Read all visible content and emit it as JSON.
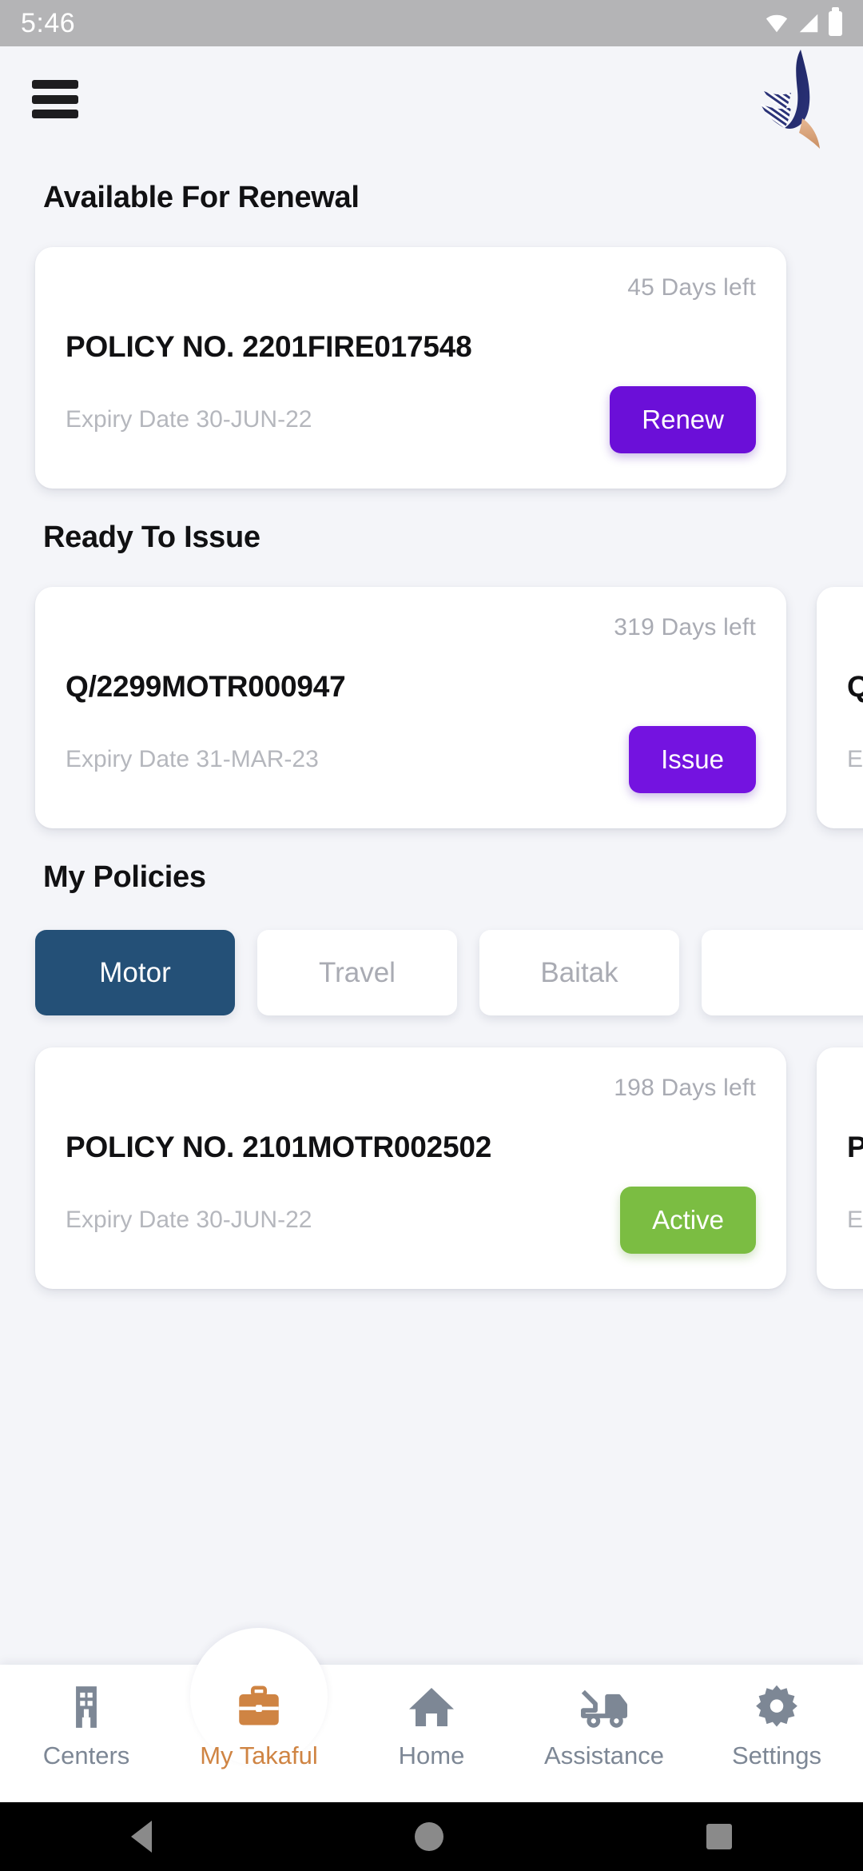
{
  "statusbar": {
    "time": "5:46",
    "icons": [
      "wifi-icon",
      "signal-icon",
      "battery-icon"
    ]
  },
  "header": {
    "menu_icon": "hamburger-menu-icon",
    "logo": "company-logo"
  },
  "sections": [
    {
      "title": "Available For Renewal",
      "cards": [
        {
          "days_left": "45 Days left",
          "policy_no": "POLICY NO. 2201FIRE017548",
          "expiry": "Expiry Date 30-JUN-22",
          "cta": "Renew",
          "cta_color": "#6b0fd8"
        }
      ]
    },
    {
      "title": "Ready To Issue",
      "cards": [
        {
          "days_left": "319 Days left",
          "policy_no": "Q/2299MOTR000947",
          "expiry": "Expiry Date 31-MAR-23",
          "cta": "Issue",
          "cta_color": "#7413e0"
        },
        {
          "days_left": "",
          "policy_no": "Q",
          "expiry": "E",
          "cta": "",
          "cta_color": "#7413e0"
        }
      ]
    },
    {
      "title": "My Policies",
      "tabs": [
        {
          "label": "Motor",
          "active": true
        },
        {
          "label": "Travel",
          "active": false
        },
        {
          "label": "Baitak",
          "active": false
        },
        {
          "label": "",
          "active": false
        }
      ],
      "cards": [
        {
          "days_left": "198 Days left",
          "policy_no": "POLICY NO. 2101MOTR002502",
          "expiry": "Expiry Date 30-JUN-22",
          "cta": "Active",
          "cta_color": "#7bbd42"
        },
        {
          "days_left": "",
          "policy_no": "P",
          "expiry": "E",
          "cta": "",
          "cta_color": "#7bbd42"
        }
      ]
    }
  ],
  "bottomnav": [
    {
      "label": "Centers",
      "icon": "building-icon",
      "active": false
    },
    {
      "label": "My Takaful",
      "icon": "briefcase-icon",
      "active": true
    },
    {
      "label": "Home",
      "icon": "house-icon",
      "active": false
    },
    {
      "label": "Assistance",
      "icon": "tow-truck-icon",
      "active": false
    },
    {
      "label": "Settings",
      "icon": "gear-icon",
      "active": false
    }
  ],
  "sysnav": [
    "back-button",
    "home-button",
    "recents-button"
  ],
  "colors": {
    "background": "#f4f5f9",
    "accent_purple": "#6b0fd8",
    "accent_green": "#7bbd42",
    "tab_active_blue": "#245077",
    "nav_active_orange": "#cf8443",
    "muted_text": "#a9abb3"
  }
}
